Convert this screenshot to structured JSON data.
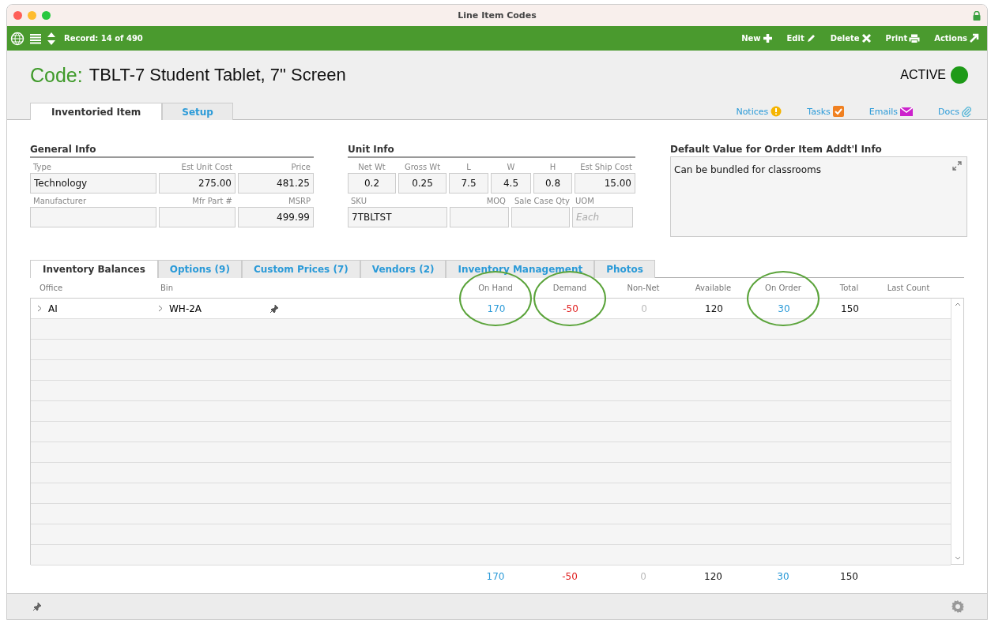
{
  "window": {
    "title": "Line Item Codes"
  },
  "toolbar": {
    "record": "Record: 14 of 490",
    "actions": [
      {
        "label": "New"
      },
      {
        "label": "Edit"
      },
      {
        "label": "Delete"
      },
      {
        "label": "Print"
      },
      {
        "label": "Actions"
      }
    ]
  },
  "header": {
    "label": "Code:",
    "value": "TBLT-7 Student Tablet, 7\" Screen",
    "status": "ACTIVE",
    "active": true
  },
  "tabs": [
    {
      "label": "Inventoried Item",
      "selected": true
    },
    {
      "label": "Setup",
      "selected": false
    }
  ],
  "links": [
    {
      "label": "Notices"
    },
    {
      "label": "Tasks"
    },
    {
      "label": "Emails"
    },
    {
      "label": "Docs"
    }
  ],
  "sections": [
    {
      "title": "General Info",
      "lines": [
        {
          "fields": [
            {
              "label": "Type",
              "value": "Technology",
              "kind": "text"
            },
            {
              "label": "Est Unit Cost",
              "value": "275.00",
              "kind": "number"
            },
            {
              "label": "Price",
              "value": "481.25",
              "kind": "number"
            }
          ]
        },
        {
          "fields": [
            {
              "label": "Manufacturer",
              "kind": "text"
            },
            {
              "label": "Mfr Part #",
              "kind": "number"
            },
            {
              "label": "MSRP",
              "value": "499.99",
              "kind": "number"
            }
          ]
        }
      ]
    },
    {
      "title": "Unit Info",
      "lines": [
        {
          "fields": [
            {
              "label": "Net Wt",
              "value": "0.2",
              "kind": "measure"
            },
            {
              "label": "Gross Wt",
              "value": "0.25",
              "kind": "measure"
            },
            {
              "label": "L",
              "value": "7.5",
              "kind": "measure"
            },
            {
              "label": "W",
              "value": "4.5",
              "kind": "measure"
            },
            {
              "label": "H",
              "value": "0.8",
              "kind": "measure"
            },
            {
              "label": "Est Ship Cost",
              "value": "15.00",
              "kind": "number"
            }
          ]
        },
        {
          "fields": [
            {
              "label": "SKU",
              "value": "7TBLTST",
              "kind": "text"
            },
            {
              "label": "MOQ",
              "kind": "number"
            },
            {
              "label": "Sale Case Qty",
              "kind": "number"
            },
            {
              "label": "UOM",
              "placeholder": "Each",
              "kind": "text"
            }
          ]
        }
      ]
    }
  ],
  "notes": {
    "title": "Default Value for Order Item Addt'l Info",
    "value": "Can be bundled for classrooms"
  },
  "subtabs": [
    {
      "label": "Inventory Balances",
      "selected": true
    },
    {
      "label": "Options (9)",
      "selected": false
    },
    {
      "label": "Custom Prices (7)",
      "selected": false
    },
    {
      "label": "Vendors (2)",
      "selected": false
    },
    {
      "label": "Inventory Management",
      "selected": false
    },
    {
      "label": "Photos",
      "selected": false
    }
  ],
  "table": {
    "columns": [
      {
        "header": "Office"
      },
      {
        "header": "Bin"
      },
      {
        "header": "On Hand",
        "kind": "link",
        "circled": true
      },
      {
        "header": "Demand",
        "kind": "negative",
        "circled": true
      },
      {
        "header": "Non-Net",
        "kind": "muted",
        "circled": false
      },
      {
        "header": "Available",
        "kind": "plain",
        "circled": false
      },
      {
        "header": "On Order",
        "kind": "link",
        "circled": true
      },
      {
        "header": "Total",
        "kind": "plain",
        "circled": false
      },
      {
        "header": "Last Count",
        "circled": false
      }
    ],
    "rows": [
      {
        "office": "AI",
        "bin": "WH-2A",
        "values": [
          "170",
          "-50",
          "0",
          "120",
          "30",
          "150"
        ]
      }
    ],
    "totals": [
      "170",
      "-50",
      "0",
      "120",
      "30",
      "150"
    ]
  }
}
